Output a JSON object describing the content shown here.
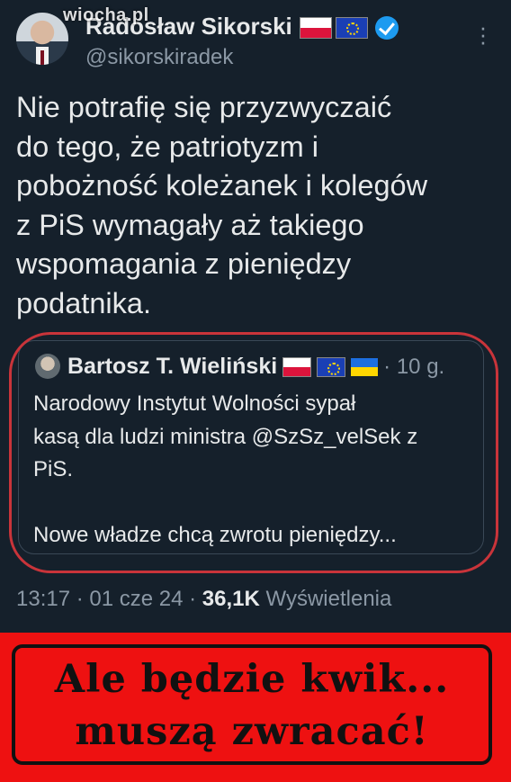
{
  "watermark": "wiocha.pl",
  "author": {
    "name": "Radosław Sikorski",
    "handle": "@sikorskiradek",
    "flags": [
      "pl-flag",
      "eu-flag"
    ],
    "verified_icon": "verified-badge-icon"
  },
  "tweet": {
    "text": "Nie potrafię się przyzwyczaić\ndo tego, że patriotyzm i\npobożność koleżanek i kolegów\nz PiS wymagały aż takiego\nwspomagania z pieniędzy\npodatnika."
  },
  "quoted_tweet": {
    "author_name": "Bartosz T. Wieliński",
    "flags": [
      "pl-flag",
      "eu-flag",
      "ua-flag"
    ],
    "time": "· 10 g.",
    "text": "Narodowy Instytut Wolności sypał\nkasą dla ludzi ministra @SzSz_velSek z\nPiS.\n\nNowe władze chcą zwrotu pieniędzy..."
  },
  "meta": {
    "time": "13:17",
    "date": "01 cze 24",
    "views_count": "36,1K",
    "views_label": "Wyświetlenia"
  },
  "banner": {
    "text": "Ale będzie kwik...\nmuszą zwracać!",
    "background_color": "#ee1111"
  },
  "colors": {
    "background": "#15202b",
    "text": "#e7e9ea",
    "muted": "#8b98a5",
    "accent": "#1d9bf0",
    "highlight_ring": "#c9343a"
  }
}
